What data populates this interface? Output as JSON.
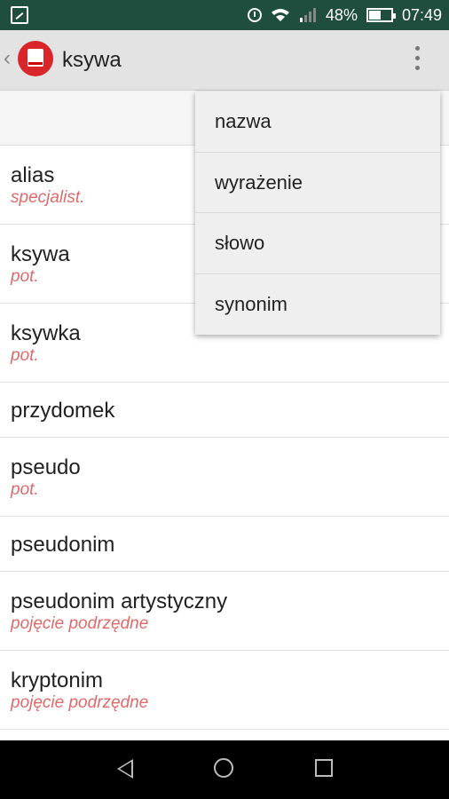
{
  "status_bar": {
    "battery_percent": "48%",
    "time": "07:49",
    "icons": [
      "gallery-icon",
      "alarm-icon",
      "wifi-icon",
      "signal-icon",
      "battery-icon"
    ]
  },
  "app_bar": {
    "title": "ksywa",
    "icons": [
      "back-chevron-icon",
      "app-logo-icon",
      "overflow-menu-icon"
    ]
  },
  "results": [
    {
      "word": "alias",
      "note": "specjalist."
    },
    {
      "word": "ksywa",
      "note": "pot."
    },
    {
      "word": "ksywka",
      "note": "pot."
    },
    {
      "word": "przydomek",
      "note": ""
    },
    {
      "word": "pseudo",
      "note": "pot."
    },
    {
      "word": "pseudonim",
      "note": ""
    },
    {
      "word": "pseudonim artystyczny",
      "note": "pojęcie podrzędne"
    },
    {
      "word": "kryptonim",
      "note": "pojęcie podrzędne"
    }
  ],
  "overflow_menu": {
    "items": [
      "nazwa",
      "wyrażenie",
      "słowo",
      "synonim"
    ]
  },
  "nav_bar": {
    "icons": [
      "back-triangle-icon",
      "home-circle-icon",
      "recents-square-icon"
    ]
  },
  "colors": {
    "status_bar": "#1f4d3e",
    "app_bar": "#e3e3e3",
    "accent_note": "#e06a6a",
    "logo": "#d9262a"
  }
}
